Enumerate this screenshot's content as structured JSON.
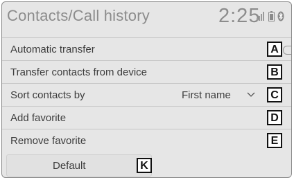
{
  "header": {
    "title": "Contacts/Call history",
    "clock": "2:25",
    "status_icons": [
      "signal-icon",
      "battery-icon",
      "bluetooth-icon"
    ]
  },
  "menu": {
    "items": [
      {
        "label": "Automatic transfer",
        "callout": "A"
      },
      {
        "label": "Transfer contacts from device",
        "callout": "B"
      },
      {
        "label": "Sort contacts by",
        "value": "First name",
        "callout": "C"
      },
      {
        "label": "Add favorite",
        "callout": "D"
      },
      {
        "label": "Remove favorite",
        "callout": "E"
      }
    ]
  },
  "footer": {
    "default_label": "Default",
    "callout": "K"
  }
}
